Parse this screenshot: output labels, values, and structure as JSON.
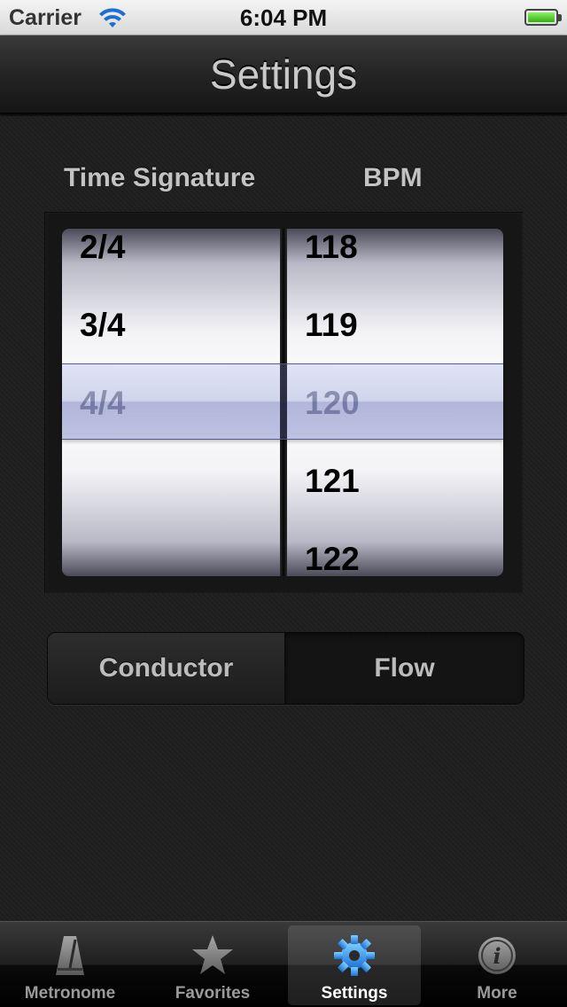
{
  "status_bar": {
    "carrier": "Carrier",
    "time": "6:04 PM",
    "wifi_icon": "wifi-icon",
    "battery_icon": "battery-icon",
    "battery_level": 1.0
  },
  "nav": {
    "title": "Settings"
  },
  "picker": {
    "time_signature_label": "Time Signature",
    "bpm_label": "BPM",
    "time_signature": {
      "visible_rows": [
        "2/4",
        "3/4",
        "4/4"
      ],
      "selected": "4/4"
    },
    "bpm": {
      "visible_rows": [
        "118",
        "119",
        "120",
        "121",
        "122"
      ],
      "selected": "120"
    }
  },
  "mode": {
    "options": [
      "Conductor",
      "Flow"
    ],
    "selected": "Flow"
  },
  "tabs": [
    {
      "label": "Metronome",
      "icon": "metronome-icon",
      "active": false
    },
    {
      "label": "Favorites",
      "icon": "star-icon",
      "active": false
    },
    {
      "label": "Settings",
      "icon": "gear-icon",
      "active": true
    },
    {
      "label": "More",
      "icon": "info-icon",
      "active": false
    }
  ],
  "colors": {
    "accent_tab_icon": "#2f8fe8",
    "selection_bar": "#9aa2d4",
    "battery": "#3fc414"
  }
}
